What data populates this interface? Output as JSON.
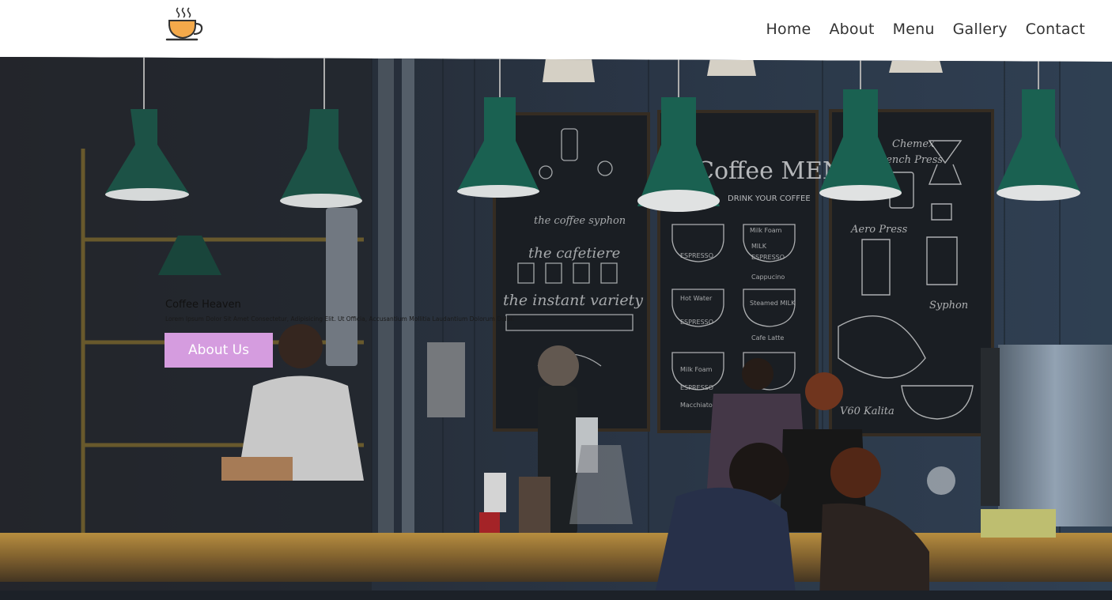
{
  "header": {
    "logo_icon": "steaming-coffee-cup-icon",
    "nav": [
      {
        "label": "Home"
      },
      {
        "label": "About"
      },
      {
        "label": "Menu"
      },
      {
        "label": "Gallery"
      },
      {
        "label": "Contact"
      }
    ]
  },
  "hero": {
    "title": "Coffee Heaven",
    "subtitle": "Lorem Ipsum Dolor Sit Amet Consectetur, Adipisicing Elit. Ut Officia, Accusantium Mollitia Laudantium Dolorum Dolor.",
    "button_label": "About Us",
    "button_color": "#d59cdf",
    "chalkboard": {
      "board1_lines": [
        "the coffee syphon",
        "the cafetiere",
        "the instant variety"
      ],
      "board2_title": "Coffee MENU",
      "board2_subtitle": "DRINK YOUR COFFEE",
      "board2_items": [
        "ESPRESSO",
        "Milk Foam",
        "MILK",
        "ESPRESSO",
        "Cappucino",
        "Hot Water",
        "Steamed MILK",
        "ESPRESSO",
        "Cafe Latte",
        "Milk Foam",
        "ESPRESSO",
        "Macchiato"
      ],
      "board3_lines": [
        "Chemex",
        "French Press",
        "Aero Press",
        "Syphon",
        "V60",
        "Kalita"
      ]
    }
  }
}
